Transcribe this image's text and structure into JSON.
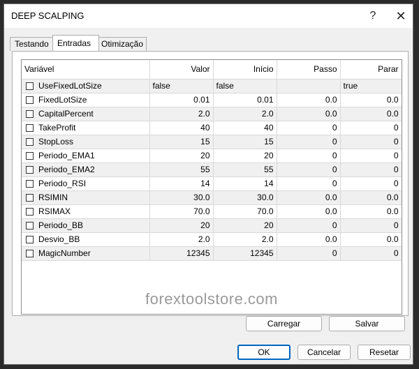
{
  "window": {
    "title": "DEEP SCALPING",
    "help_label": "?",
    "close_label": "✕"
  },
  "tabs": [
    {
      "label": "Testando",
      "active": false
    },
    {
      "label": "Entradas",
      "active": true
    },
    {
      "label": "Otimização",
      "active": false
    }
  ],
  "table": {
    "headers": {
      "name": "Variável",
      "value": "Valor",
      "start": "Início",
      "step": "Passo",
      "stop": "Parar"
    },
    "rows": [
      {
        "name": "UseFixedLotSize",
        "checked": false,
        "value": "false",
        "start": "false",
        "step": "",
        "stop": "true",
        "text": true
      },
      {
        "name": "FixedLotSize",
        "checked": false,
        "value": "0.01",
        "start": "0.01",
        "step": "0.0",
        "stop": "0.0"
      },
      {
        "name": "CapitalPercent",
        "checked": false,
        "value": "2.0",
        "start": "2.0",
        "step": "0.0",
        "stop": "0.0"
      },
      {
        "name": "TakeProfit",
        "checked": false,
        "value": "40",
        "start": "40",
        "step": "0",
        "stop": "0"
      },
      {
        "name": "StopLoss",
        "checked": false,
        "value": "15",
        "start": "15",
        "step": "0",
        "stop": "0"
      },
      {
        "name": "Periodo_EMA1",
        "checked": false,
        "value": "20",
        "start": "20",
        "step": "0",
        "stop": "0"
      },
      {
        "name": "Periodo_EMA2",
        "checked": false,
        "value": "55",
        "start": "55",
        "step": "0",
        "stop": "0"
      },
      {
        "name": "Periodo_RSI",
        "checked": false,
        "value": "14",
        "start": "14",
        "step": "0",
        "stop": "0"
      },
      {
        "name": "RSIMIN",
        "checked": false,
        "value": "30.0",
        "start": "30.0",
        "step": "0.0",
        "stop": "0.0"
      },
      {
        "name": "RSIMAX",
        "checked": false,
        "value": "70.0",
        "start": "70.0",
        "step": "0.0",
        "stop": "0.0"
      },
      {
        "name": "Periodo_BB",
        "checked": false,
        "value": "20",
        "start": "20",
        "step": "0",
        "stop": "0"
      },
      {
        "name": "Desvio_BB",
        "checked": false,
        "value": "2.0",
        "start": "2.0",
        "step": "0.0",
        "stop": "0.0"
      },
      {
        "name": "MagicNumber",
        "checked": false,
        "value": "12345",
        "start": "12345",
        "step": "0",
        "stop": "0"
      }
    ]
  },
  "watermark": "forextoolstore.com",
  "buttons": {
    "load": "Carregar",
    "save": "Salvar",
    "ok": "OK",
    "cancel": "Cancelar",
    "reset": "Resetar"
  },
  "colors": {
    "accent": "#0067c0",
    "row_alt": "#f0f0f0"
  }
}
